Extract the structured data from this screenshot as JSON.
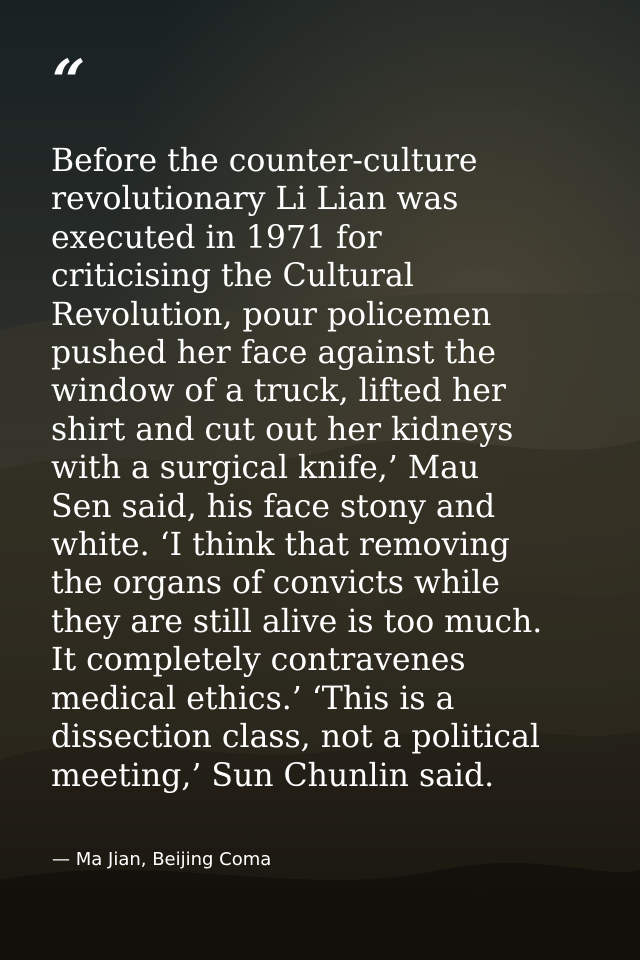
{
  "quote": {
    "mark": "“",
    "text": "Before the counter-culture\nrevolutionary Li Lian was\nexecuted in 1971 for\ncriticising the Cultural\nRevolution, pour policemen\npushed her face against the\nwindow of a truck, lifted her\nshirt and cut out her kidneys\nwith a surgical knife,’ Mau\nSen said, his face stony and\nwhite. ‘I think that removing\nthe organs of convicts while\nthey are still alive is too much.\nIt completely contravenes\nmedical ethics.’ ‘This is a\ndissection class, not a political\nmeeting,’ Sun Chunlin said.",
    "attribution": "— Ma Jian, Beijing Coma"
  },
  "colors": {
    "text": "#ffffff",
    "sky_top": "#1e2a2c",
    "hills": "#4a4636",
    "ground": "#1c1812"
  }
}
